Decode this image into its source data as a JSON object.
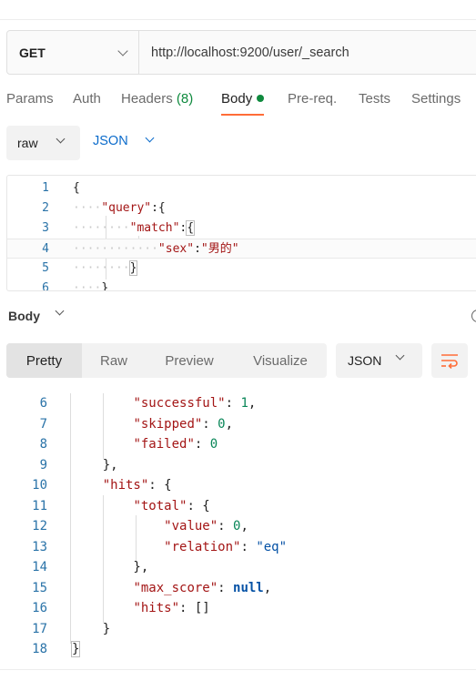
{
  "request": {
    "method": "GET",
    "url": "http://localhost:9200/user/_search"
  },
  "tabs": [
    {
      "label": "Params"
    },
    {
      "label": "Auth"
    },
    {
      "label": "Headers ",
      "count": "(8)"
    },
    {
      "label": "Body"
    },
    {
      "label": "Pre-req."
    },
    {
      "label": "Tests"
    },
    {
      "label": "Settings"
    }
  ],
  "body_mode": "raw",
  "body_language": "JSON",
  "editor_lines": [
    {
      "n": "1"
    },
    {
      "n": "2"
    },
    {
      "n": "3"
    },
    {
      "n": "4"
    },
    {
      "n": "5"
    },
    {
      "n": "6"
    }
  ],
  "editor": {
    "query_key": "\"query\"",
    "match_key": "\"match\"",
    "sex_key": "\"sex\"",
    "sex_value": "\"男的\""
  },
  "response": {
    "title": "Body",
    "view_tabs": [
      "Pretty",
      "Raw",
      "Preview",
      "Visualize"
    ],
    "format": "JSON",
    "line_numbers": [
      "6",
      "7",
      "8",
      "9",
      "10",
      "11",
      "12",
      "13",
      "14",
      "15",
      "16",
      "17",
      "18"
    ],
    "keys": {
      "successful": "\"successful\"",
      "skipped": "\"skipped\"",
      "failed": "\"failed\"",
      "hits": "\"hits\"",
      "total": "\"total\"",
      "value": "\"value\"",
      "relation": "\"relation\"",
      "max_score": "\"max_score\"",
      "hits_inner": "\"hits\""
    },
    "values": {
      "successful": "1",
      "skipped": "0",
      "failed": "0",
      "value": "0",
      "relation": "\"eq\"",
      "max_score": "null",
      "hits_inner": "[]"
    }
  },
  "colors": {
    "accent": "#ff6c37",
    "green": "#0f8a3e",
    "blue": "#0b6bcb"
  },
  "icons": {
    "method_dropdown": "chevron-down-icon",
    "body_status": "dot-icon",
    "wrap": "wrap-lines-icon"
  }
}
